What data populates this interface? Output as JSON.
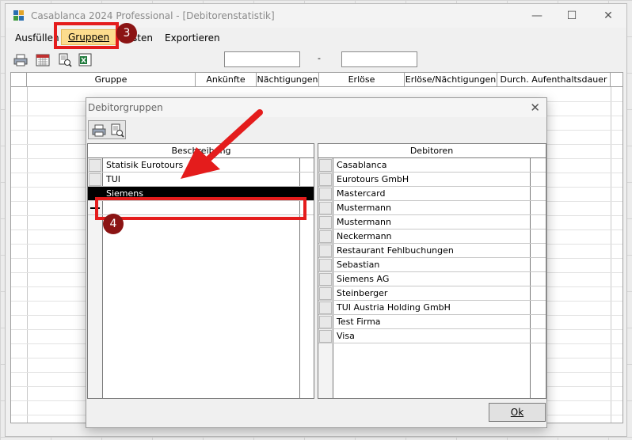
{
  "window": {
    "title": "Casablanca 2024 Professional - [Debitorenstatistik]",
    "controls": [
      "—",
      "☐",
      "✕"
    ]
  },
  "menu": {
    "items": [
      {
        "label": "Ausfüllen"
      },
      {
        "label": "Gruppen"
      },
      {
        "label": "Listen"
      },
      {
        "label": "Exportieren"
      }
    ]
  },
  "main_grid": {
    "columns": [
      "Gruppe",
      "Ankünfte",
      "Nächtigungen",
      "Erlöse",
      "Erlöse/Nächtigungen",
      "Durch. Aufenthaltsdauer"
    ]
  },
  "dialog": {
    "title": "Debitorgruppen",
    "close": "✕",
    "left_header": "Beschreibung",
    "right_header": "Debitoren",
    "groups": [
      "Statisik Eurotours",
      "TUI",
      "Siemens",
      ""
    ],
    "selected_group": "Siemens",
    "debtors": [
      "Casablanca",
      "Eurotours GmbH",
      "Mastercard",
      "Mustermann",
      "Mustermann",
      "Neckermann",
      "Restaurant Fehlbuchungen",
      "Sebastian",
      "Siemens AG",
      "Steinberger",
      "TUI Austria Holding GmbH",
      "Test Firma",
      "Visa"
    ],
    "ok_label": "Ok"
  },
  "annotations": {
    "step3": "3",
    "step4": "4",
    "color": "#e41c1c"
  }
}
